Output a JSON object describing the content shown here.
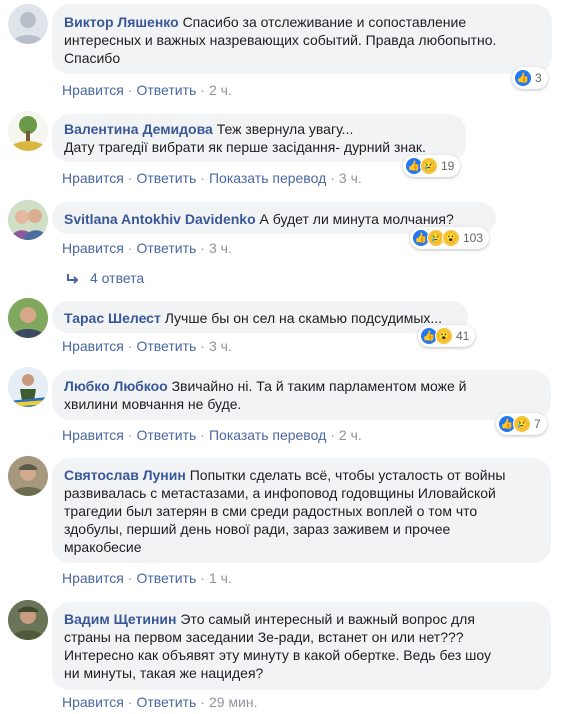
{
  "comments": [
    {
      "author": "Виктор Ляшенко",
      "lines": [
        "Спасибо за отслеживание и сопоставление",
        "интересных и важных назревающих событий. Правда любопытно.",
        "Спасибо"
      ],
      "like": "Нравится",
      "reply": "Ответить",
      "translate": "",
      "time": "2 ч.",
      "reactions": [
        "like"
      ],
      "count": "3"
    },
    {
      "author": "Валентина Демидова",
      "lines": [
        "Теж звернула увагу...",
        "Дату трагедії вибрати як перше засідання- дурний знак."
      ],
      "like": "Нравится",
      "reply": "Ответить",
      "translate": "Показать перевод",
      "time": "3 ч.",
      "reactions": [
        "like",
        "sad"
      ],
      "count": "19"
    },
    {
      "author": "Svitlana Antokhiv Davidenko",
      "lines": [
        "А будет ли минута молчания?"
      ],
      "like": "Нравится",
      "reply": "Ответить",
      "translate": "",
      "time": "3 ч.",
      "reactions": [
        "like",
        "sad",
        "wow"
      ],
      "count": "103"
    },
    {
      "author": "Тарас Шелест",
      "lines": [
        "Лучше бы он сел на скамью подсудимых..."
      ],
      "like": "Нравится",
      "reply": "Ответить",
      "translate": "",
      "time": "3 ч.",
      "reactions": [
        "like",
        "wow"
      ],
      "count": "41"
    },
    {
      "author": "Любко Любкоо",
      "lines": [
        "Звичайно ні. Та й таким парламентом може й",
        "хвилини мовчання не буде."
      ],
      "like": "Нравится",
      "reply": "Ответить",
      "translate": "Показать перевод",
      "time": "2 ч.",
      "reactions": [
        "like",
        "sad"
      ],
      "count": "7"
    },
    {
      "author": "Святослав Лунин",
      "lines": [
        "Попытки сделать всё, чтобы усталость от войны",
        "развивалась с метастазами, а инфоповод годовщины Иловайской",
        "трагедии был затерян в сми среди радостных воплей о том что",
        "здобулы, перший день нової ради, зараз заживем и прочее",
        "мракобесие"
      ],
      "like": "Нравится",
      "reply": "Ответить",
      "translate": "",
      "time": "1 ч.",
      "reactions": [],
      "count": ""
    },
    {
      "author": "Вадим Щетинин",
      "lines": [
        "Это самый интересный и важный вопрос для",
        "страны на первом заседании Зе-ради, встанет он или нет???",
        "Интересно как объявят эту минуту в какой обертке. Ведь без шоу",
        "ни минуты, такая же нацидея?"
      ],
      "like": "Нравится",
      "reply": "Ответить",
      "translate": "",
      "time": "29 мин.",
      "reactions": [],
      "count": ""
    }
  ],
  "replies_link": "4 ответа",
  "colors": {
    "name": "#385898",
    "link": "#4b67a1",
    "bubble": "#f2f3f5",
    "meta": "#90949c"
  }
}
